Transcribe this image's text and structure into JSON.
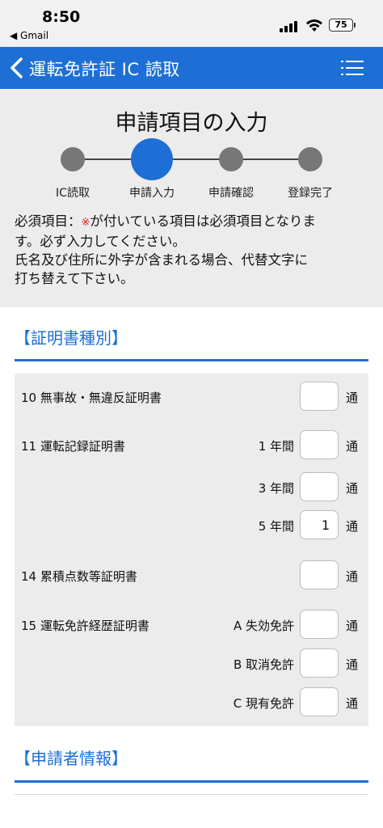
{
  "status_bar": {
    "time": "8:50",
    "back_app": "◀ Gmail",
    "battery": "75",
    "icons": [
      "cellular-signal-icon",
      "wifi-icon",
      "battery-icon"
    ]
  },
  "nav": {
    "title": "運転免許証 IC 読取",
    "back_icon": "chevron-left-icon",
    "menu_icon": "list-menu-icon"
  },
  "intro": {
    "page_title": "申請項目の入力",
    "steps": [
      {
        "label": "IC読取",
        "active": false
      },
      {
        "label": "申請入力",
        "active": true
      },
      {
        "label": "申請確認",
        "active": false
      },
      {
        "label": "登録完了",
        "active": false
      }
    ],
    "notice_prefix": "必須項目：",
    "required_mark": "※",
    "notice_line1_rest": "が付いている項目は必須項目となりま",
    "notice_line2": "す。必ず入力してください。",
    "notice_line3": "氏名及び住所に外字が含まれる場合、代替文字に",
    "notice_line4": "打ち替えて下さい。"
  },
  "colors": {
    "accent": "#1d6fd6",
    "panel_bg": "#ececec",
    "required": "#e0201b"
  },
  "certificate_section": {
    "title": "【証明書種別】",
    "unit_label": "通",
    "rows": [
      {
        "label": "10 無事故・無違反証明書",
        "sub": "",
        "value": ""
      },
      {
        "label": "11 運転記録証明書",
        "sub": "1 年間",
        "value": ""
      },
      {
        "label": "",
        "sub": "3 年間",
        "value": ""
      },
      {
        "label": "",
        "sub": "5 年間",
        "value": "1"
      },
      {
        "label": "14 累積点数等証明書",
        "sub": "",
        "value": ""
      },
      {
        "label": "15 運転免許経歴証明書",
        "sub": "A 失効免許",
        "value": ""
      },
      {
        "label": "",
        "sub": "B 取消免許",
        "value": ""
      },
      {
        "label": "",
        "sub": "C 現有免許",
        "value": ""
      }
    ]
  },
  "applicant_section": {
    "title": "【申請者情報】"
  }
}
